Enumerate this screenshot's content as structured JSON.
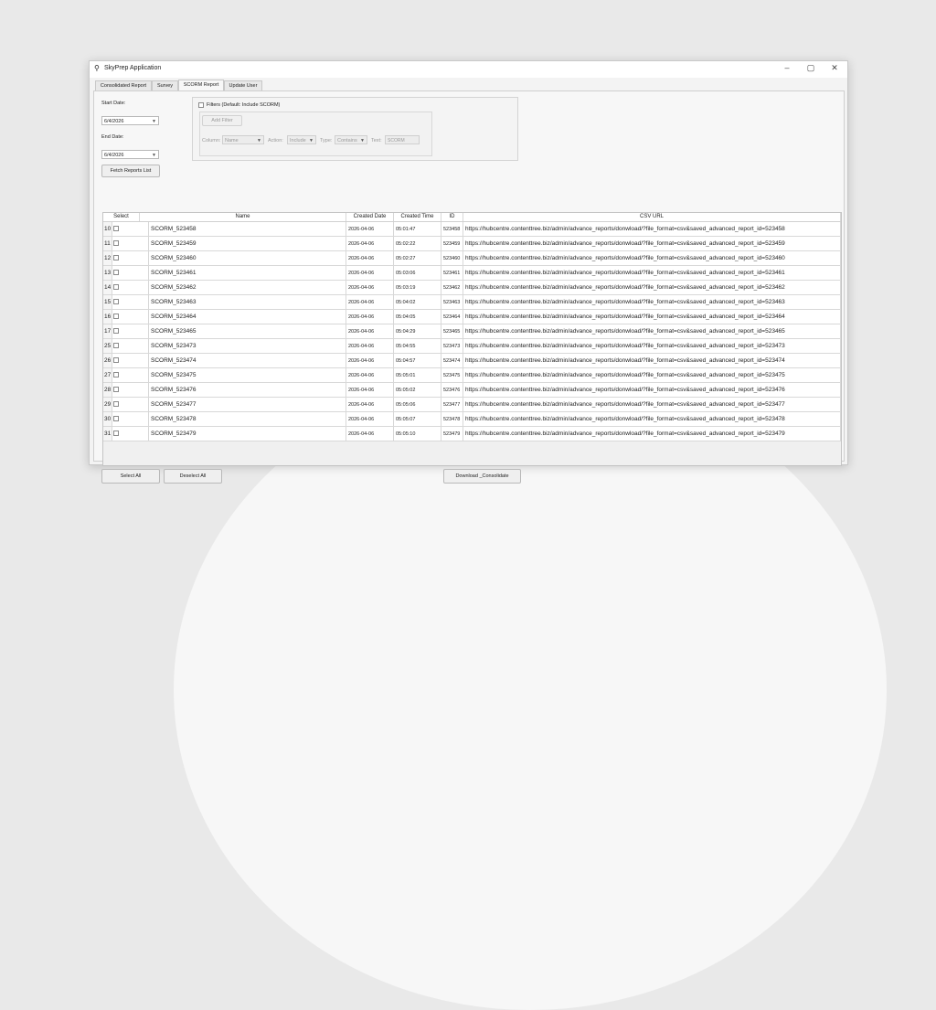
{
  "window": {
    "title": "SkyPrep Application",
    "app_icon": "user-icon",
    "controls": {
      "minimize": "–",
      "maximize": "▢",
      "close": "✕"
    }
  },
  "tabs": [
    {
      "label": "Consolidated Report",
      "active": false
    },
    {
      "label": "Survey",
      "active": false
    },
    {
      "label": "SCORM Report",
      "active": true
    },
    {
      "label": "Update User",
      "active": false
    }
  ],
  "form": {
    "start_date_label": "Start Date:",
    "start_date_value": "6/4/2026",
    "end_date_label": "End Date:",
    "end_date_value": "6/4/2026",
    "fetch_button": "Fetch Reports List"
  },
  "filters": {
    "checkbox_label": "Filters (Default: Include SCORM)",
    "checked": false,
    "add_filter_button": "Add Filter",
    "column_label": "Column:",
    "column_value": "Name",
    "action_label": "Action:",
    "action_value": "Include",
    "type_label": "Type:",
    "type_value": "Contains",
    "text_label": "Text:",
    "text_value": "SCORM"
  },
  "table": {
    "headers": {
      "select": "Select",
      "name": "Name",
      "created_date": "Created Date",
      "created_time": "Created Time",
      "id": "ID",
      "csv_url": "CSV URL"
    },
    "rows": [
      {
        "num": "10",
        "name": "SCORM_523458",
        "date": "2026-04-06",
        "time": "05:01:47",
        "id": "523458",
        "url": "https://hubcentre.contenttree.biz/admin/advance_reports/donwload/?file_format=csv&saved_advanced_report_id=523458"
      },
      {
        "num": "11",
        "name": "SCORM_523459",
        "date": "2026-04-06",
        "time": "05:02:22",
        "id": "523459",
        "url": "https://hubcentre.contenttree.biz/admin/advance_reports/donwload/?file_format=csv&saved_advanced_report_id=523459"
      },
      {
        "num": "12",
        "name": "SCORM_523460",
        "date": "2026-04-06",
        "time": "05:02:27",
        "id": "523460",
        "url": "https://hubcentre.contenttree.biz/admin/advance_reports/donwload/?file_format=csv&saved_advanced_report_id=523460"
      },
      {
        "num": "13",
        "name": "SCORM_523461",
        "date": "2026-04-06",
        "time": "05:03:06",
        "id": "523461",
        "url": "https://hubcentre.contenttree.biz/admin/advance_reports/donwload/?file_format=csv&saved_advanced_report_id=523461"
      },
      {
        "num": "14",
        "name": "SCORM_523462",
        "date": "2026-04-06",
        "time": "05:03:19",
        "id": "523462",
        "url": "https://hubcentre.contenttree.biz/admin/advance_reports/donwload/?file_format=csv&saved_advanced_report_id=523462"
      },
      {
        "num": "15",
        "name": "SCORM_523463",
        "date": "2026-04-06",
        "time": "05:04:02",
        "id": "523463",
        "url": "https://hubcentre.contenttree.biz/admin/advance_reports/donwload/?file_format=csv&saved_advanced_report_id=523463"
      },
      {
        "num": "16",
        "name": "SCORM_523464",
        "date": "2026-04-06",
        "time": "05:04:05",
        "id": "523464",
        "url": "https://hubcentre.contenttree.biz/admin/advance_reports/donwload/?file_format=csv&saved_advanced_report_id=523464"
      },
      {
        "num": "17",
        "name": "SCORM_523465",
        "date": "2026-04-06",
        "time": "05:04:29",
        "id": "523465",
        "url": "https://hubcentre.contenttree.biz/admin/advance_reports/donwload/?file_format=csv&saved_advanced_report_id=523465"
      },
      {
        "num": "25",
        "name": "SCORM_523473",
        "date": "2026-04-06",
        "time": "05:04:55",
        "id": "523473",
        "url": "https://hubcentre.contenttree.biz/admin/advance_reports/donwload/?file_format=csv&saved_advanced_report_id=523473"
      },
      {
        "num": "26",
        "name": "SCORM_523474",
        "date": "2026-04-06",
        "time": "05:04:57",
        "id": "523474",
        "url": "https://hubcentre.contenttree.biz/admin/advance_reports/donwload/?file_format=csv&saved_advanced_report_id=523474"
      },
      {
        "num": "27",
        "name": "SCORM_523475",
        "date": "2026-04-06",
        "time": "05:05:01",
        "id": "523475",
        "url": "https://hubcentre.contenttree.biz/admin/advance_reports/donwload/?file_format=csv&saved_advanced_report_id=523475"
      },
      {
        "num": "28",
        "name": "SCORM_523476",
        "date": "2026-04-06",
        "time": "05:05:02",
        "id": "523476",
        "url": "https://hubcentre.contenttree.biz/admin/advance_reports/donwload/?file_format=csv&saved_advanced_report_id=523476"
      },
      {
        "num": "29",
        "name": "SCORM_523477",
        "date": "2026-04-06",
        "time": "05:05:06",
        "id": "523477",
        "url": "https://hubcentre.contenttree.biz/admin/advance_reports/donwload/?file_format=csv&saved_advanced_report_id=523477"
      },
      {
        "num": "30",
        "name": "SCORM_523478",
        "date": "2026-04-06",
        "time": "05:05:07",
        "id": "523478",
        "url": "https://hubcentre.contenttree.biz/admin/advance_reports/donwload/?file_format=csv&saved_advanced_report_id=523478"
      },
      {
        "num": "31",
        "name": "SCORM_523479",
        "date": "2026-04-06",
        "time": "05:05:10",
        "id": "523479",
        "url": "https://hubcentre.contenttree.biz/admin/advance_reports/donwload/?file_format=csv&saved_advanced_report_id=523479"
      }
    ]
  },
  "footer": {
    "select_all": "Select All",
    "deselect_all": "Deselect All",
    "download": "Download _Consolidate"
  }
}
